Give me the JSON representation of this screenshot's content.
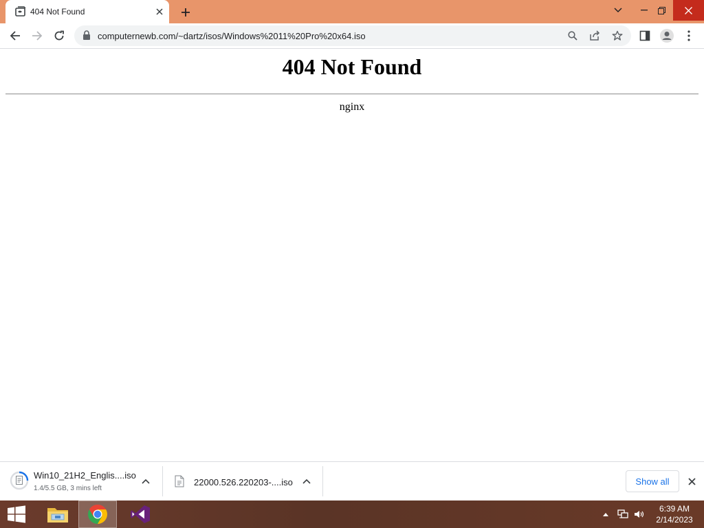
{
  "browser": {
    "tab": {
      "title": "404 Not Found",
      "favicon": "nginx-favicon-icon"
    },
    "address_bar": {
      "url": "computernewb.com/~dartz/isos/Windows%2011%20Pro%20x64.iso"
    },
    "accent_color": "#e8956a"
  },
  "page": {
    "heading": "404 Not Found",
    "server": "nginx"
  },
  "downloads": {
    "items": [
      {
        "name": "Win10_21H2_Englis....iso",
        "status": "1.4/5.5 GB, 3 mins left",
        "progress": 0.25
      },
      {
        "name": "22000.526.220203-....iso",
        "status": ""
      }
    ],
    "show_all_label": "Show all"
  },
  "taskbar": {
    "apps": [
      "windows-start",
      "file-explorer",
      "google-chrome",
      "visual-studio"
    ],
    "clock": {
      "time": "6:39 AM",
      "date": "2/14/2023"
    }
  }
}
